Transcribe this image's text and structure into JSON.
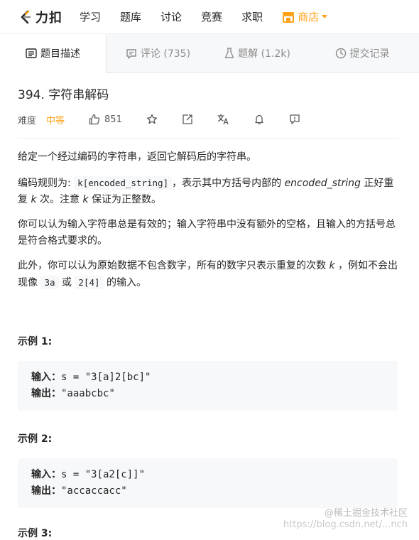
{
  "topnav": {
    "logo_text": "力扣",
    "items": [
      "学习",
      "题库",
      "讨论",
      "竞赛",
      "求职"
    ],
    "store_label": "商店"
  },
  "tabs": [
    {
      "label": "题目描述",
      "icon": "description-icon"
    },
    {
      "label": "评论 (735)",
      "icon": "comment-icon"
    },
    {
      "label": "题解 (1.2k)",
      "icon": "flask-icon"
    },
    {
      "label": "提交记录",
      "icon": "clock-icon"
    }
  ],
  "problem": {
    "title": "394. 字符串解码",
    "difficulty_label": "难度",
    "difficulty": "中等",
    "likes": "851"
  },
  "description": {
    "p1": "给定一个经过编码的字符串，返回它解码后的字符串。",
    "p2_a": "编码规则为: ",
    "p2_code": "k[encoded_string]",
    "p2_b": "，表示其中方括号内部的 ",
    "p2_var": "encoded_string",
    "p2_c": " 正好重复 ",
    "p2_k1": "k",
    "p2_d": " 次。注意 ",
    "p2_k2": "k",
    "p2_e": " 保证为正整数。",
    "p3": "你可以认为输入字符串总是有效的；输入字符串中没有额外的空格，且输入的方括号总是符合格式要求的。",
    "p4_a": "此外，你可以认为原始数据不包含数字，所有的数字只表示重复的次数 ",
    "p4_k": "k",
    "p4_b": " ，例如不会出现像 ",
    "p4_code1": "3a",
    "p4_c": " 或 ",
    "p4_code2": "2[4]",
    "p4_d": " 的输入。"
  },
  "examples": [
    {
      "title": "示例 1:",
      "input_label": "输入：",
      "input": "s = \"3[a]2[bc]\"",
      "output_label": "输出：",
      "output": "\"aaabcbc\""
    },
    {
      "title": "示例 2:",
      "input_label": "输入：",
      "input": "s = \"3[a2[c]]\"",
      "output_label": "输出：",
      "output": "\"accaccacc\""
    },
    {
      "title": "示例 3:"
    }
  ],
  "watermark": {
    "line1": "@稀土掘金技术社区",
    "line2": "https://blog.csdn.net/...nch"
  },
  "colors": {
    "accent": "#ffa116",
    "text": "#262626",
    "muted": "#8c8c8c"
  }
}
